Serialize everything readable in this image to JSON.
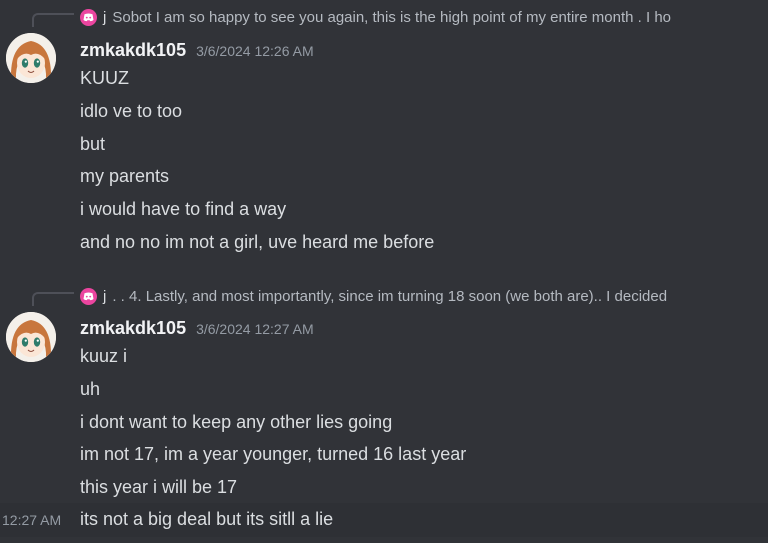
{
  "messages": [
    {
      "reply": {
        "author": "j",
        "text": "Sobot I am so happy to see you again, this is the high point of my entire month . I ho"
      },
      "username": "zmkakdk105",
      "timestamp": "3/6/2024 12:26 AM",
      "lines": [
        "KUUZ",
        "idlo ve to too",
        "but",
        "my parents",
        "i would have to find a way",
        "and no no im not a girl, uve heard me before"
      ]
    },
    {
      "reply": {
        "author": "j",
        "text": ". . 4. Lastly, and most importantly, since im turning 18 soon (we both are).. I decided"
      },
      "username": "zmkakdk105",
      "timestamp": "3/6/2024 12:27 AM",
      "lines": [
        "kuuz i",
        "uh",
        "i dont want to keep any other lies going",
        "im not 17, im a year younger, turned 16 last year",
        "this year i will be 17",
        "its not a big deal but its sitll a lie"
      ],
      "hover_time": "12:27 AM"
    }
  ],
  "colors": {
    "background": "#313338",
    "reply_badge": "#eb459f",
    "username": "#f2f3f5",
    "text": "#dbdee1",
    "muted": "#949ba4"
  },
  "icons": {
    "reply_badge": "discord-icon",
    "avatar": "anime-avatar"
  }
}
